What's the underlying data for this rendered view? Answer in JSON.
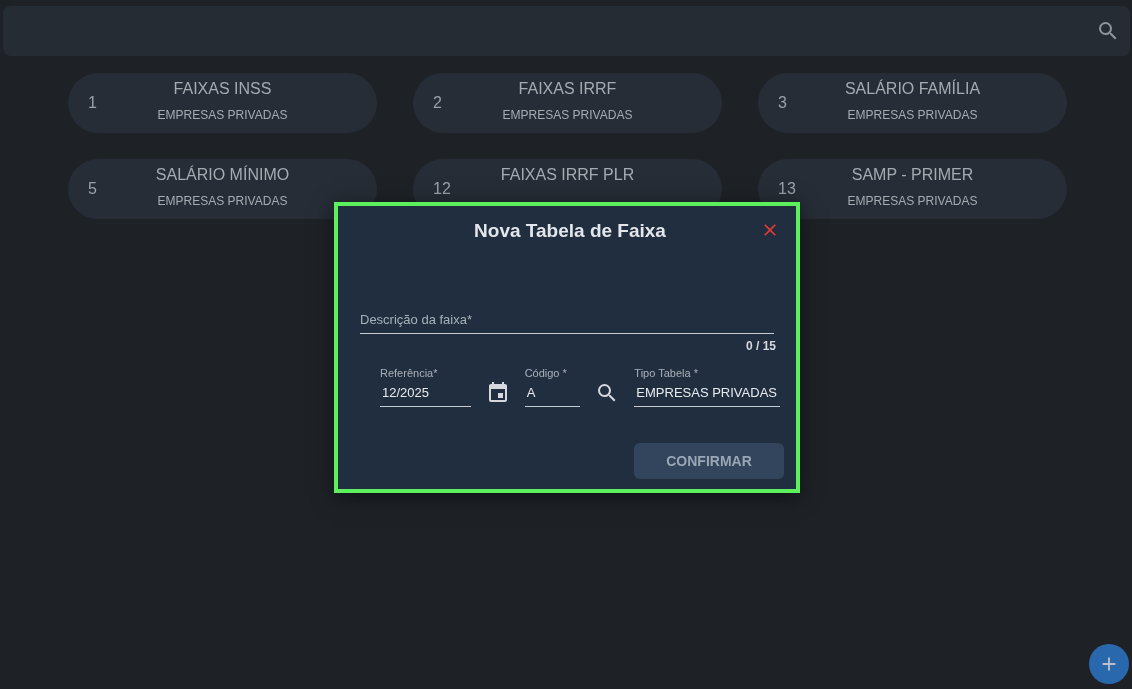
{
  "cards": [
    {
      "number": "1",
      "title": "FAIXAS INSS",
      "subtitle": "EMPRESAS PRIVADAS"
    },
    {
      "number": "2",
      "title": "FAIXAS IRRF",
      "subtitle": "EMPRESAS PRIVADAS"
    },
    {
      "number": "3",
      "title": "SALÁRIO FAMÍLIA",
      "subtitle": "EMPRESAS PRIVADAS"
    },
    {
      "number": "5",
      "title": "SALÁRIO MÍNIMO",
      "subtitle": "EMPRESAS PRIVADAS"
    },
    {
      "number": "12",
      "title": "FAIXAS IRRF PLR"
    },
    {
      "number": "13",
      "title": "SAMP - PRIMER",
      "subtitle": "EMPRESAS PRIVADAS"
    }
  ],
  "dialog": {
    "title": "Nova Tabela de Faixa",
    "description": {
      "label": "Descrição da faixa*",
      "counter": "0 / 15"
    },
    "fields": [
      {
        "kind": "date",
        "label": "Referência*",
        "value": "12/2025"
      },
      {
        "kind": "lookup",
        "label": "Código *",
        "value": "A"
      },
      {
        "kind": "text",
        "label": "Tipo Tabela *",
        "value": "EMPRESAS PRIVADAS"
      }
    ],
    "confirm": {
      "label": "CONFIRMAR",
      "disabled": true
    }
  }
}
